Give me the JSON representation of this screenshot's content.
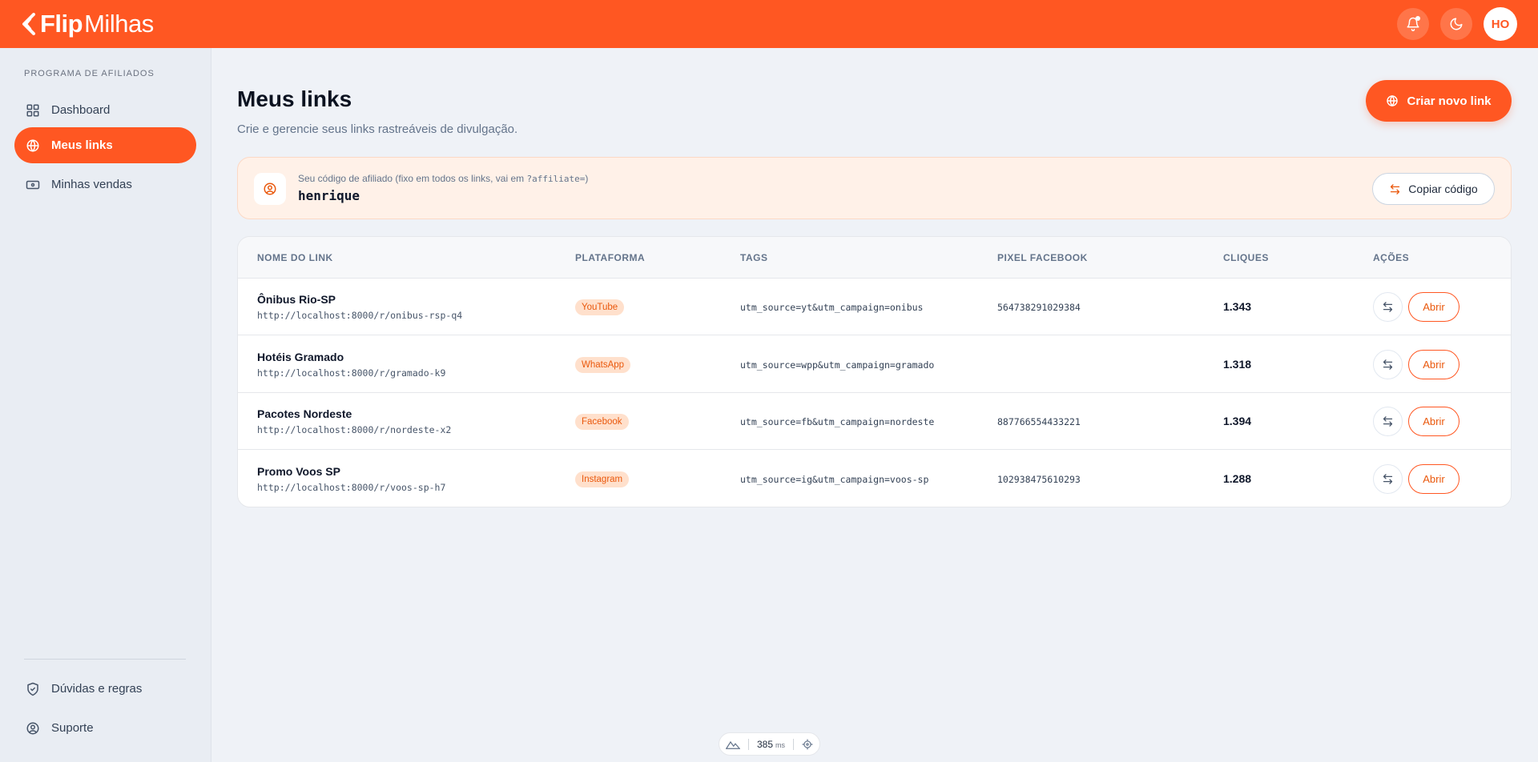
{
  "header": {
    "brand_bold": "Flip",
    "brand_light": "Milhas",
    "avatar_initials": "HO",
    "icons": [
      "bell-icon",
      "moon-icon"
    ]
  },
  "sidebar": {
    "section_title": "PROGRAMA DE AFILIADOS",
    "items": [
      {
        "label": "Dashboard",
        "icon": "grid-icon"
      },
      {
        "label": "Meus links",
        "icon": "globe-icon",
        "active": true
      },
      {
        "label": "Minhas vendas",
        "icon": "ticket-icon"
      }
    ],
    "footer_items": [
      {
        "label": "Dúvidas e regras",
        "icon": "shield-check-icon"
      },
      {
        "label": "Suporte",
        "icon": "user-circle-icon"
      }
    ]
  },
  "page": {
    "title": "Meus links",
    "subtitle": "Crie e gerencie seus links rastreáveis de divulgação.",
    "create_button": "Criar novo link"
  },
  "affiliate": {
    "label_prefix": "Seu código de afiliado (fixo em todos os links, vai em ",
    "label_param": "?affiliate=",
    "label_suffix": ")",
    "code": "henrique",
    "copy_button": "Copiar código"
  },
  "table": {
    "columns": [
      "NOME DO LINK",
      "PLATAFORMA",
      "TAGS",
      "PIXEL FACEBOOK",
      "CLIQUES",
      "AÇÕES"
    ],
    "open_label": "Abrir",
    "rows": [
      {
        "name": "Ônibus Rio-SP",
        "url": "http://localhost:8000/r/onibus-rsp-q4",
        "platform": "YouTube",
        "tags": "utm_source=yt&utm_campaign=onibus",
        "pixel": "564738291029384",
        "clicks": "1.343"
      },
      {
        "name": "Hotéis Gramado",
        "url": "http://localhost:8000/r/gramado-k9",
        "platform": "WhatsApp",
        "tags": "utm_source=wpp&utm_campaign=gramado",
        "pixel": "",
        "clicks": "1.318"
      },
      {
        "name": "Pacotes Nordeste",
        "url": "http://localhost:8000/r/nordeste-x2",
        "platform": "Facebook",
        "tags": "utm_source=fb&utm_campaign=nordeste",
        "pixel": "887766554433221",
        "clicks": "1.394"
      },
      {
        "name": "Promo Voos SP",
        "url": "http://localhost:8000/r/voos-sp-h7",
        "platform": "Instagram",
        "tags": "utm_source=ig&utm_campaign=voos-sp",
        "pixel": "102938475610293",
        "clicks": "1.288"
      }
    ]
  },
  "perf": {
    "value": "385",
    "unit": "ms"
  },
  "colors": {
    "brand": "#ff5722",
    "badge_bg": "#ffe0cc",
    "badge_text": "#ea580c"
  }
}
